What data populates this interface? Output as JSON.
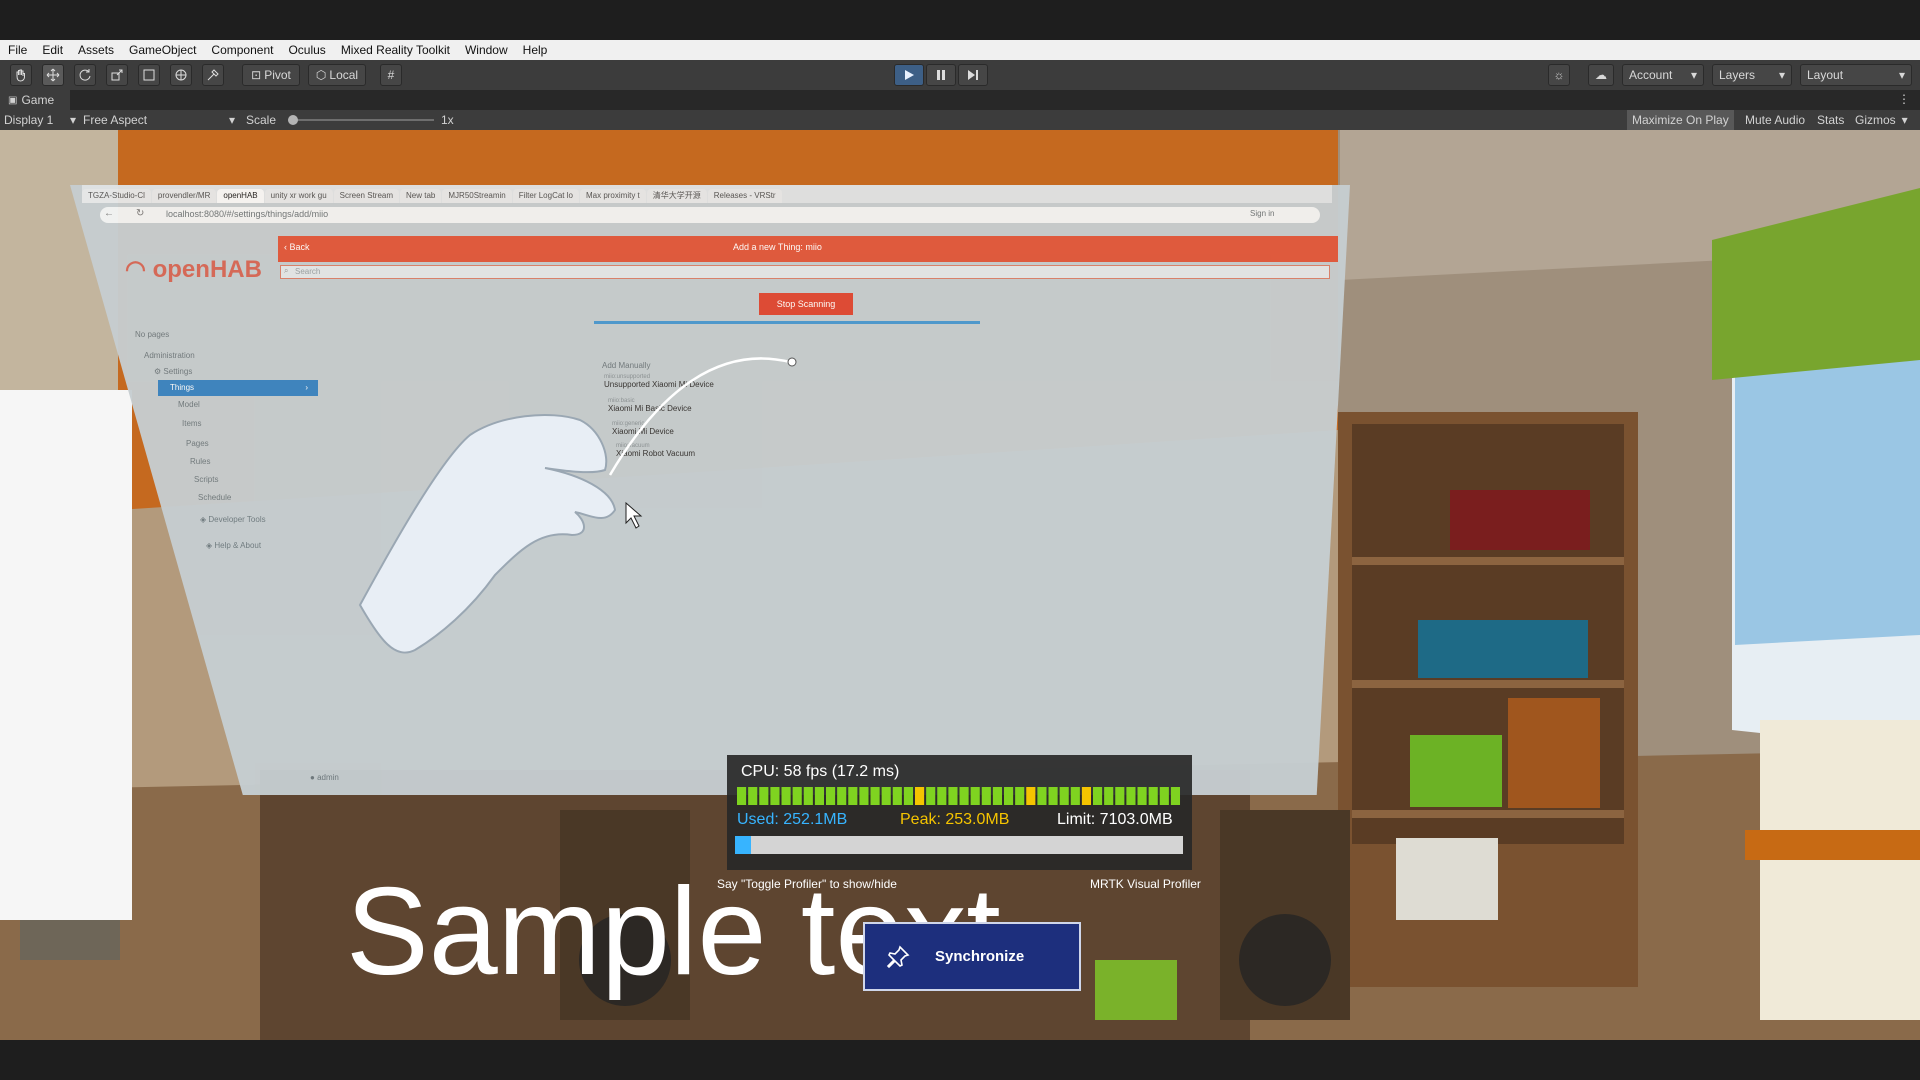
{
  "menu": [
    "File",
    "Edit",
    "Assets",
    "GameObject",
    "Component",
    "Oculus",
    "Mixed Reality Toolkit",
    "Window",
    "Help"
  ],
  "toolbar": {
    "pivot_label": "Pivot",
    "local_label": "Local",
    "account_label": "Account",
    "layers_label": "Layers",
    "layout_label": "Layout"
  },
  "game_tab": {
    "label": "Game"
  },
  "game_controls": {
    "display": "Display 1",
    "aspect": "Free Aspect",
    "scale_label": "Scale",
    "scale_value": "1x",
    "scale_fraction": 0.0,
    "maximize": "Maximize On Play",
    "mute": "Mute Audio",
    "stats": "Stats",
    "gizmos": "Gizmos"
  },
  "browser": {
    "tabs": [
      "TGZA-Studio-Cl",
      "provendler/MR",
      "openHAB",
      "unity xr work gu",
      "Screen Stream",
      "New tab",
      "MJR50Streamin",
      "Filter LogCat lo",
      "Max proximity t",
      "清华大学开源",
      "Releases - VRStr"
    ],
    "url": "localhost:8080/#/settings/things/add/miio",
    "sign_in": "Sign in",
    "logo_text": "openHAB",
    "back_label": "Back",
    "header_title": "Add a new Thing: miio",
    "search_placeholder": "Search",
    "stop_scanning": "Stop Scanning",
    "no_pages": "No pages",
    "administration": "Administration",
    "settings": "Settings",
    "things": "Things",
    "sidebar_sub": [
      "Model",
      "Items",
      "Pages",
      "Rules",
      "Scripts",
      "Schedule"
    ],
    "developer_tools": "Developer Tools",
    "help_about": "Help & About",
    "admin_user": "admin",
    "add_manually": "Add Manually",
    "devices": [
      {
        "id": "miio:unsupported",
        "name": "Unsupported Xiaomi Mi Device"
      },
      {
        "id": "miio:basic",
        "name": "Xiaomi Mi Basic Device"
      },
      {
        "id": "miio:generic",
        "name": "Xiaomi Mi Device"
      },
      {
        "id": "miio:vacuum",
        "name": "Xiaomi Robot Vacuum"
      }
    ]
  },
  "profiler": {
    "cpu": "CPU: 58 fps (17.2 ms)",
    "used": "Used: 252.1MB",
    "peak": "Peak: 253.0MB",
    "limit": "Limit: 7103.0MB",
    "memory_fraction": 0.035,
    "hint": "Say \"Toggle Profiler\" to show/hide",
    "title": "MRTK Visual Profiler",
    "frame_bars": [
      "g",
      "g",
      "g",
      "g",
      "g",
      "g",
      "g",
      "g",
      "g",
      "g",
      "g",
      "g",
      "g",
      "g",
      "g",
      "g",
      "y",
      "g",
      "g",
      "g",
      "g",
      "g",
      "g",
      "g",
      "g",
      "g",
      "y",
      "g",
      "g",
      "g",
      "g",
      "y",
      "g",
      "g",
      "g",
      "g",
      "g",
      "g",
      "g",
      "g"
    ],
    "colors": {
      "good": "#7fd320",
      "warn": "#f5c400",
      "used": "#37b4ff",
      "peak": "#f5c400"
    }
  },
  "sample_text": "Sample text",
  "sync_button": "Synchronize"
}
